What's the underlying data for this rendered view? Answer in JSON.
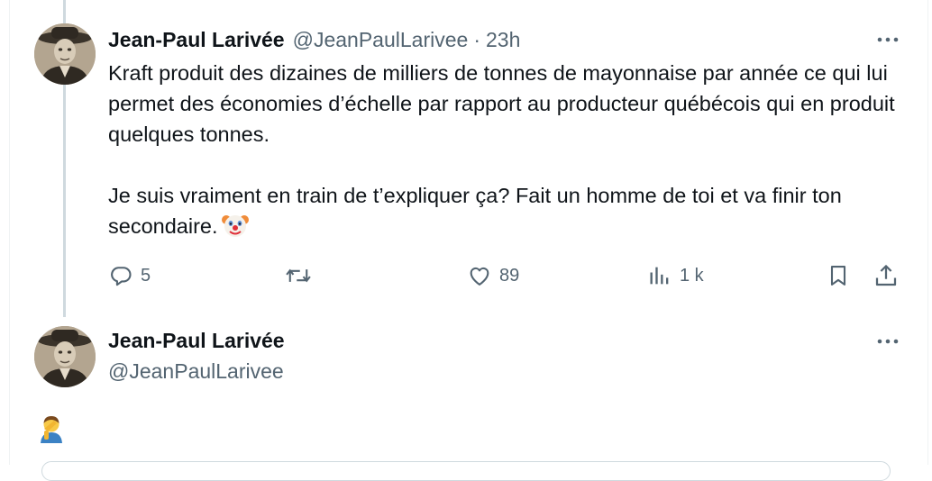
{
  "tweet": {
    "display_name": "Jean-Paul Larivée",
    "handle": "@JeanPaulLarivee",
    "separator": "·",
    "time": "23h",
    "paragraph1": "Kraft produit des dizaines de milliers de tonnes de mayonnaise par année ce qui lui permet des économies d’échelle par rapport au producteur québécois qui en produit quelques tonnes.",
    "paragraph2": "Je suis vraiment en train de t’expliquer ça? Fait un homme de toi et va finir ton secondaire.",
    "emoji": "clown-face-emoji",
    "actions": {
      "reply_count": "5",
      "retweet_count": "",
      "like_count": "89",
      "views_count": "1 k"
    }
  },
  "reply": {
    "display_name": "Jean-Paul Larivée",
    "handle": "@JeanPaulLarivee",
    "emoji": "person-facepalming-emoji"
  },
  "colors": {
    "text_primary": "#0f1419",
    "text_secondary": "#536471",
    "thread_line": "#cfd9de",
    "border": "#eff3f4"
  },
  "icons": [
    "more-icon",
    "reply-icon",
    "retweet-icon",
    "like-icon",
    "views-icon",
    "bookmark-icon",
    "share-icon"
  ]
}
